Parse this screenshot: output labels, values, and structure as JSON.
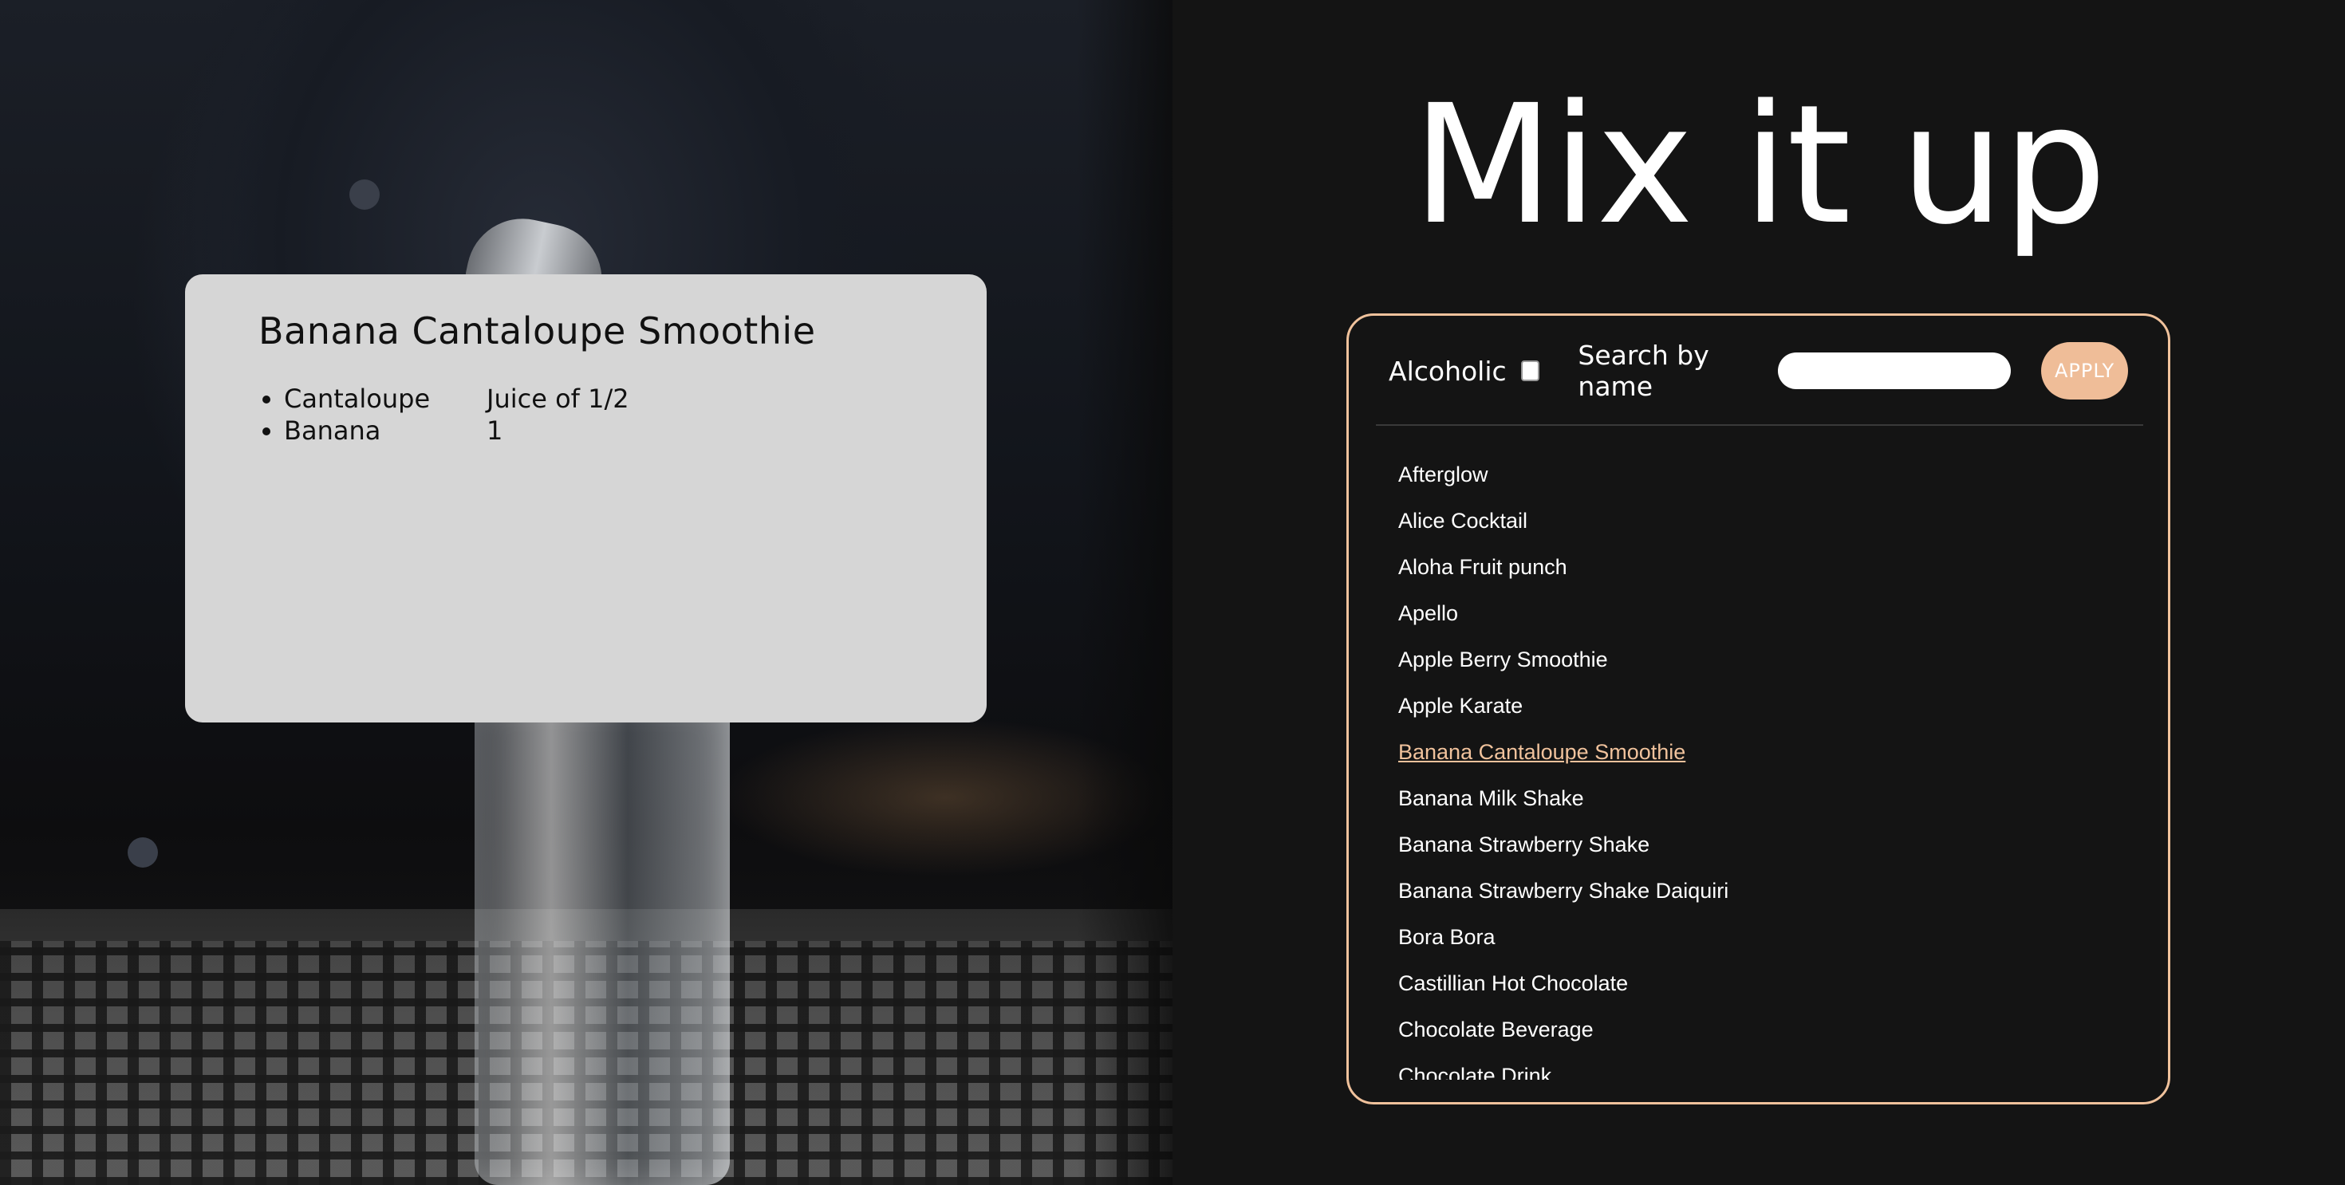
{
  "app": {
    "title": "Mix it up"
  },
  "recipe_card": {
    "name": "Banana Cantaloupe Smoothie",
    "ingredients": [
      {
        "ingredient": "Cantaloupe",
        "measure": "Juice of 1/2"
      },
      {
        "ingredient": "Banana",
        "measure": "1"
      }
    ]
  },
  "filters": {
    "alcoholic_label": "Alcoholic",
    "alcoholic_checked": false,
    "search_label": "Search by name",
    "search_value": "",
    "apply_label": "APPLY"
  },
  "drinks": {
    "selected": "Banana Cantaloupe Smoothie",
    "items": [
      "Afterglow",
      "Alice Cocktail",
      "Aloha Fruit punch",
      "Apello",
      "Apple Berry Smoothie",
      "Apple Karate",
      "Banana Cantaloupe Smoothie",
      "Banana Milk Shake",
      "Banana Strawberry Shake",
      "Banana Strawberry Shake Daiquiri",
      "Bora Bora",
      "Castillian Hot Chocolate",
      "Chocolate Beverage",
      "Chocolate Drink"
    ]
  },
  "colors": {
    "background": "#141414",
    "accent": "#f0c29c",
    "apply_button": "#efbd98",
    "card": "#d6d6d6"
  }
}
